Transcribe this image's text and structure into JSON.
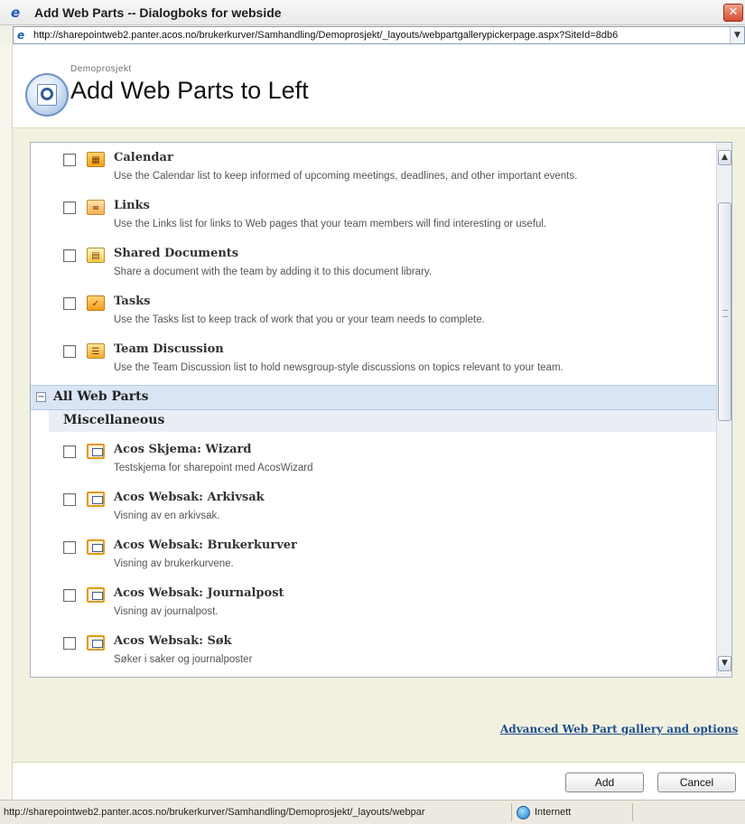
{
  "window": {
    "title": "Add Web Parts -- Dialogboks for webside",
    "close_glyph": "✕"
  },
  "address": {
    "url": "http://sharepointweb2.panter.acos.no/brukerkurver/Samhandling/Demoprosjekt/_layouts/webpartgallerypickerpage.aspx?SiteId=8db6"
  },
  "header": {
    "site_name": "Demoprosjekt",
    "title": "Add Web Parts to Left"
  },
  "list_items": [
    {
      "name": "Calendar",
      "description": "Use the Calendar list to keep informed of upcoming meetings, deadlines, and other important events.",
      "icon": "calendar-icon",
      "checked": false
    },
    {
      "name": "Links",
      "description": "Use the Links list for links to Web pages that your team members will find interesting or useful.",
      "icon": "links-icon",
      "checked": false
    },
    {
      "name": "Shared Documents",
      "description": "Share a document with the team by adding it to this document library.",
      "icon": "document-library-icon",
      "checked": false
    },
    {
      "name": "Tasks",
      "description": "Use the Tasks list to keep track of work that you or your team needs to complete.",
      "icon": "tasks-icon",
      "checked": false
    },
    {
      "name": "Team Discussion",
      "description": "Use the Team Discussion list to hold newsgroup-style discussions on topics relevant to your team.",
      "icon": "discussion-icon",
      "checked": false
    }
  ],
  "section": {
    "title": "All Web Parts",
    "toggle": "−",
    "category": "Miscellaneous"
  },
  "web_parts": [
    {
      "name": "Acos Skjema: Wizard",
      "description": "Testskjema for sharepoint med AcosWizard",
      "icon": "web-part-icon",
      "checked": false
    },
    {
      "name": "Acos Websak: Arkivsak",
      "description": "Visning av en arkivsak.",
      "icon": "web-part-icon",
      "checked": false
    },
    {
      "name": "Acos Websak: Brukerkurver",
      "description": "Visning av brukerkurvene.",
      "icon": "web-part-icon",
      "checked": false
    },
    {
      "name": "Acos Websak: Journalpost",
      "description": "Visning av journalpost.",
      "icon": "web-part-icon",
      "checked": false
    },
    {
      "name": "Acos Websak: Søk",
      "description": "Søker i saker og journalposter",
      "icon": "web-part-icon",
      "checked": false
    }
  ],
  "links": {
    "advanced": "Advanced Web Part gallery and options"
  },
  "buttons": {
    "add": "Add",
    "cancel": "Cancel"
  },
  "status": {
    "url": "http://sharepointweb2.panter.acos.no/brukerkurver/Samhandling/Demoprosjekt/_layouts/webpar",
    "zone": "Internett"
  }
}
